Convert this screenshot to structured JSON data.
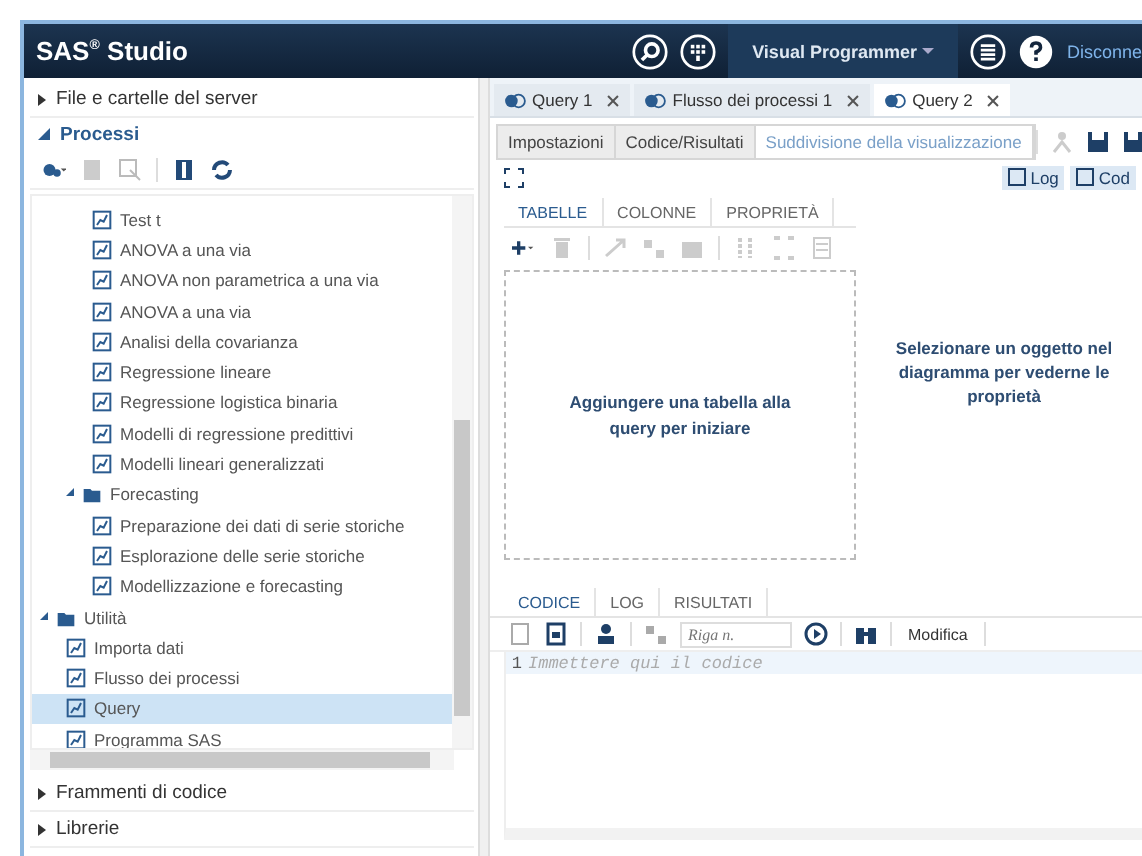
{
  "header": {
    "title": "SAS$^{®}$ Studio",
    "perspective": "Visual Programmer",
    "link": "Disconne"
  },
  "sidebar": {
    "sections_top": [
      {
        "label": "File e cartelle del server",
        "expanded": false
      },
      {
        "label": "Processi",
        "expanded": true
      }
    ],
    "tree": [
      {
        "kind": "group",
        "children": [
          {
            "kind": "group",
            "children": [
              {
                "kind": "leaf",
                "label": "Test t",
                "selected": false
              },
              {
                "kind": "leaf",
                "label": "ANOVA a una via",
                "selected": false
              },
              {
                "kind": "leaf",
                "label": "ANOVA non parametrica a una via",
                "selected": false
              },
              {
                "kind": "leaf",
                "label": "ANOVA a una via",
                "selected": false
              },
              {
                "kind": "leaf",
                "label": "Analisi della covarianza",
                "selected": false
              },
              {
                "kind": "leaf",
                "label": "Regressione lineare",
                "selected": false
              },
              {
                "kind": "leaf",
                "label": "Regressione logistica binaria",
                "selected": false
              },
              {
                "kind": "leaf",
                "label": "Modelli di regressione predittivi",
                "selected": false
              },
              {
                "kind": "leaf",
                "label": "Modelli lineari generalizzati",
                "selected": false
              }
            ]
          },
          {
            "kind": "folder",
            "label": "Forecasting",
            "expanded": true,
            "children": [
              {
                "kind": "leaf",
                "label": "Preparazione dei dati di serie storiche",
                "selected": false
              },
              {
                "kind": "leaf",
                "label": "Esplorazione delle serie storiche",
                "selected": false
              },
              {
                "kind": "leaf",
                "label": "Modellizzazione e forecasting",
                "selected": false
              }
            ]
          }
        ]
      },
      {
        "kind": "folder",
        "label": "Utilità",
        "expanded": true,
        "children": [
          {
            "kind": "leaf",
            "label": "Importa dati",
            "selected": false
          },
          {
            "kind": "leaf",
            "label": "Flusso dei processi",
            "selected": false
          },
          {
            "kind": "leaf",
            "label": "Query",
            "selected": true
          },
          {
            "kind": "leaf",
            "label": "Programma SAS",
            "selected": false
          }
        ]
      }
    ],
    "sections_bottom": [
      {
        "label": "Frammenti di codice",
        "expanded": false
      },
      {
        "label": "Librerie",
        "expanded": false
      }
    ]
  },
  "tabs": [
    {
      "label": "Query 1",
      "selected": false
    },
    {
      "label": "Flusso dei processi 1",
      "selected": false
    },
    {
      "label": "Query 2",
      "selected": true
    }
  ],
  "view_tabs": [
    {
      "label": "Impostazioni",
      "selected": false
    },
    {
      "label": "Codice/Risultati",
      "selected": false
    },
    {
      "label": "Suddivisione della visualizzazione",
      "selected": true
    }
  ],
  "view_buttons": [
    "Log",
    "Cod"
  ],
  "query_tabs": [
    {
      "label": "TABELLE",
      "selected": true
    },
    {
      "label": "COLONNE",
      "selected": false
    },
    {
      "label": "PROPRIETÀ",
      "selected": false
    }
  ],
  "canvas_hint": "Aggiungere una tabella alla query per iniziare",
  "properties_hint": "Selezionare un oggetto nel diagramma per vederne le proprietà",
  "code_tabs": [
    {
      "label": "CODICE",
      "selected": true
    },
    {
      "label": "LOG",
      "selected": false
    },
    {
      "label": "RISULTATI",
      "selected": false
    }
  ],
  "code_toolbar": {
    "line_placeholder": "Riga n.",
    "edit_button": "Modifica"
  },
  "editor": {
    "lines": [
      {
        "number": "1",
        "placeholder": "Immettere qui il codice"
      }
    ]
  }
}
